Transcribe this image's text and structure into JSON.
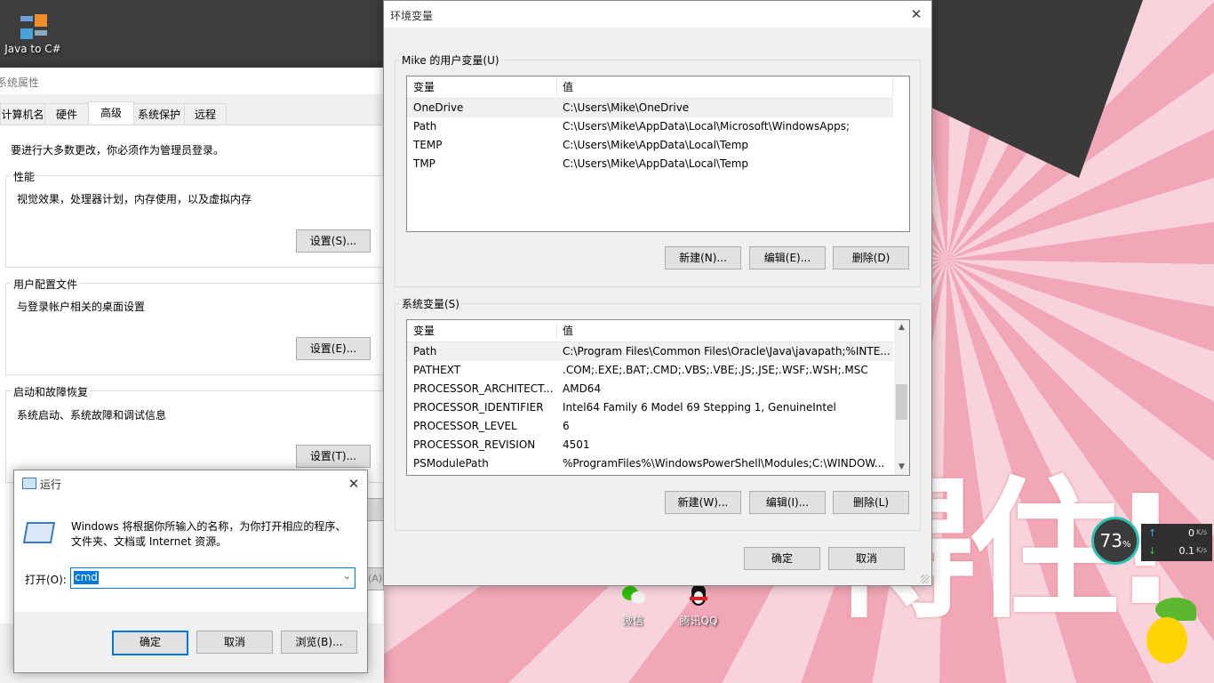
{
  "desktop": {
    "icons": [
      {
        "label": "Java to C#"
      },
      {
        "label": "微信"
      },
      {
        "label": "腾讯QQ"
      }
    ],
    "wallpaper_text": "得住!"
  },
  "net_widget": {
    "percent": "73",
    "percent_sign": "%",
    "upload": "0",
    "download": "0.1",
    "unit": "K/s"
  },
  "sysprops": {
    "title": "系统属性",
    "tabs": [
      "计算机名",
      "硬件",
      "高级",
      "系统保护",
      "远程"
    ],
    "admin_note": "要进行大多数更改，你必须作为管理员登录。",
    "groups": [
      {
        "label": "性能",
        "desc": "视觉效果，处理器计划，内存使用，以及虚拟内存",
        "button": "设置(S)..."
      },
      {
        "label": "用户配置文件",
        "desc": "与登录帐户相关的桌面设置",
        "button": "设置(E)..."
      },
      {
        "label": "启动和故障恢复",
        "desc": "系统启动、系统故障和调试信息",
        "button": "设置(T)..."
      }
    ],
    "partial_button": "(A)"
  },
  "envvars": {
    "title": "环境变量",
    "user_label": "Mike 的用户变量(U)",
    "col_var": "变量",
    "col_val": "值",
    "user_vars": [
      {
        "name": "OneDrive",
        "value": "C:\\Users\\Mike\\OneDrive"
      },
      {
        "name": "Path",
        "value": "C:\\Users\\Mike\\AppData\\Local\\Microsoft\\WindowsApps;"
      },
      {
        "name": "TEMP",
        "value": "C:\\Users\\Mike\\AppData\\Local\\Temp"
      },
      {
        "name": "TMP",
        "value": "C:\\Users\\Mike\\AppData\\Local\\Temp"
      }
    ],
    "user_buttons": {
      "new": "新建(N)...",
      "edit": "编辑(E)...",
      "delete": "删除(D)"
    },
    "sys_label": "系统变量(S)",
    "sys_vars": [
      {
        "name": "Path",
        "value": "C:\\Program Files\\Common Files\\Oracle\\Java\\javapath;%INTE..."
      },
      {
        "name": "PATHEXT",
        "value": ".COM;.EXE;.BAT;.CMD;.VBS;.VBE;.JS;.JSE;.WSF;.WSH;.MSC"
      },
      {
        "name": "PROCESSOR_ARCHITECT...",
        "value": "AMD64"
      },
      {
        "name": "PROCESSOR_IDENTIFIER",
        "value": "Intel64 Family 6 Model 69 Stepping 1, GenuineIntel"
      },
      {
        "name": "PROCESSOR_LEVEL",
        "value": "6"
      },
      {
        "name": "PROCESSOR_REVISION",
        "value": "4501"
      },
      {
        "name": "PSModulePath",
        "value": "%ProgramFiles%\\WindowsPowerShell\\Modules;C:\\WINDOW..."
      }
    ],
    "sys_buttons": {
      "new": "新建(W)...",
      "edit": "编辑(I)...",
      "delete": "删除(L)"
    },
    "ok": "确定",
    "cancel": "取消"
  },
  "run": {
    "title": "运行",
    "desc_line1": "Windows 将根据你所输入的名称，为你打开相应的程序、",
    "desc_line2": "文件夹、文档或 Internet 资源。",
    "open_label": "打开(O):",
    "input_value": "cmd",
    "ok": "确定",
    "cancel": "取消",
    "browse": "浏览(B)..."
  },
  "colors": {
    "accent": "#0078d7",
    "selection": "#0078d7"
  }
}
